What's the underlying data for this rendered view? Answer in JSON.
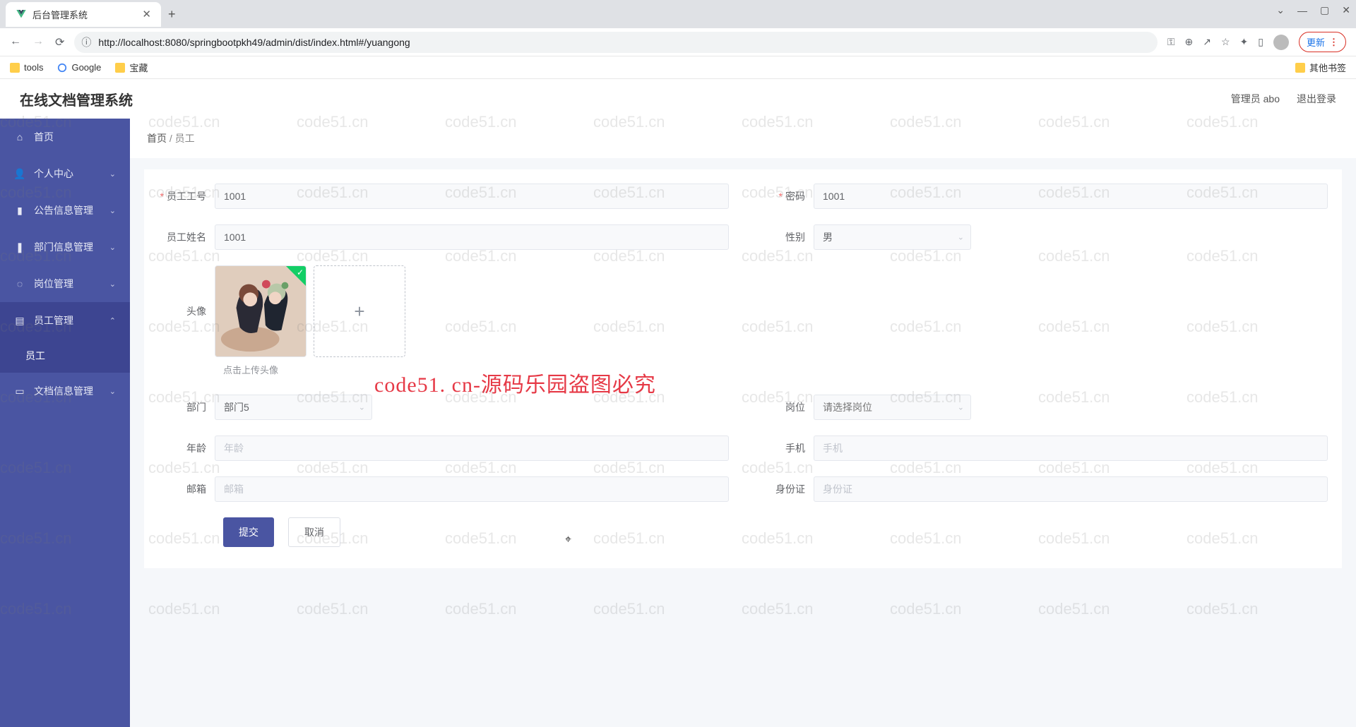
{
  "browser": {
    "tab_title": "后台管理系统",
    "url": "http://localhost:8080/springbootpkh49/admin/dist/index.html#/yuangong",
    "update_label": "更新",
    "bookmarks": [
      "tools",
      "Google",
      "宝藏"
    ],
    "bookmark_other": "其他书签"
  },
  "header": {
    "title": "在线文档管理系统",
    "user": "管理员 abo",
    "logout": "退出登录"
  },
  "sidebar": {
    "items": [
      {
        "label": "首页",
        "icon": "⌂"
      },
      {
        "label": "个人中心",
        "icon": "👤",
        "expandable": true
      },
      {
        "label": "公告信息管理",
        "icon": "▮",
        "expandable": true
      },
      {
        "label": "部门信息管理",
        "icon": "❚",
        "expandable": true
      },
      {
        "label": "岗位管理",
        "icon": "◌",
        "expandable": true
      },
      {
        "label": "员工管理",
        "icon": "▤",
        "expandable": true,
        "open": true,
        "children": [
          "员工"
        ]
      },
      {
        "label": "文档信息管理",
        "icon": "▭",
        "expandable": true
      }
    ]
  },
  "breadcrumb": {
    "home": "首页",
    "sep": "/",
    "current": "员工"
  },
  "form": {
    "employee_id_label": "员工工号",
    "employee_id_value": "1001",
    "password_label": "密码",
    "password_value": "1001",
    "name_label": "员工姓名",
    "name_value": "1001",
    "gender_label": "性别",
    "gender_value": "男",
    "avatar_label": "头像",
    "avatar_hint": "点击上传头像",
    "dept_label": "部门",
    "dept_value": "部门5",
    "post_label": "岗位",
    "post_placeholder": "请选择岗位",
    "age_label": "年龄",
    "age_placeholder": "年龄",
    "phone_label": "手机",
    "phone_placeholder": "手机",
    "email_label": "邮箱",
    "email_placeholder": "邮箱",
    "idcard_label": "身份证",
    "idcard_placeholder": "身份证",
    "submit": "提交",
    "cancel": "取消"
  },
  "watermark": {
    "banner": "code51. cn-源码乐园盗图必究",
    "text": "code51.cn"
  }
}
